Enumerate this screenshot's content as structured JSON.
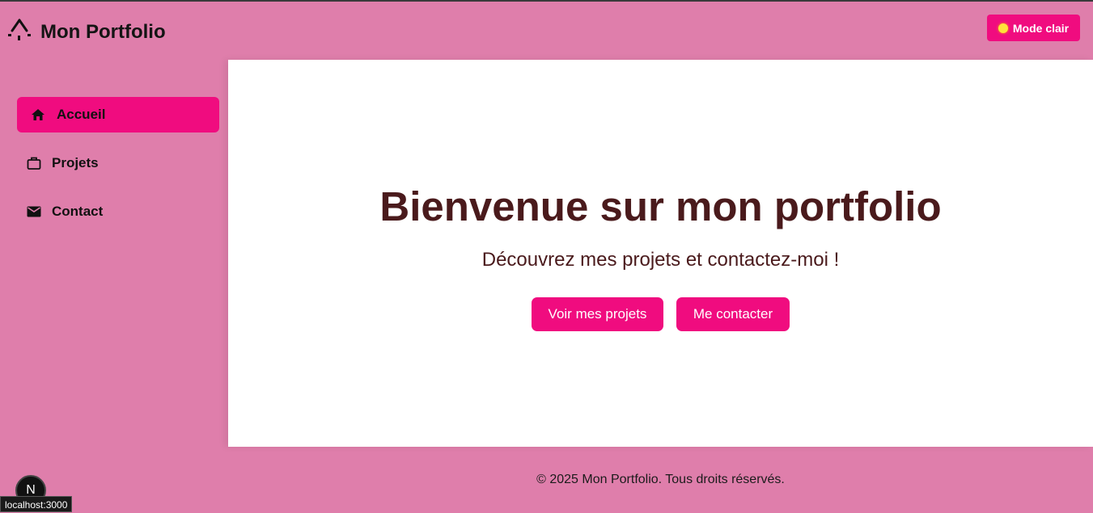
{
  "header": {
    "brand": "Mon Portfolio",
    "theme_button": "Mode clair"
  },
  "sidebar": {
    "items": [
      {
        "label": "Accueil",
        "icon": "home-icon",
        "active": true
      },
      {
        "label": "Projets",
        "icon": "briefcase-icon",
        "active": false
      },
      {
        "label": "Contact",
        "icon": "mail-icon",
        "active": false
      }
    ]
  },
  "main": {
    "title": "Bienvenue sur mon portfolio",
    "subtitle": "Découvrez mes projets et contactez-moi !",
    "buttons": {
      "projects": "Voir mes projets",
      "contact": "Me contacter"
    }
  },
  "footer": {
    "copyright": "© 2025 Mon Portfolio. Tous droits réservés."
  },
  "overlay": {
    "next_badge": "N",
    "status_url": "localhost:3000"
  },
  "colors": {
    "background": "#df7eab",
    "accent": "#f00c7f",
    "heading": "#4a1a1c"
  }
}
